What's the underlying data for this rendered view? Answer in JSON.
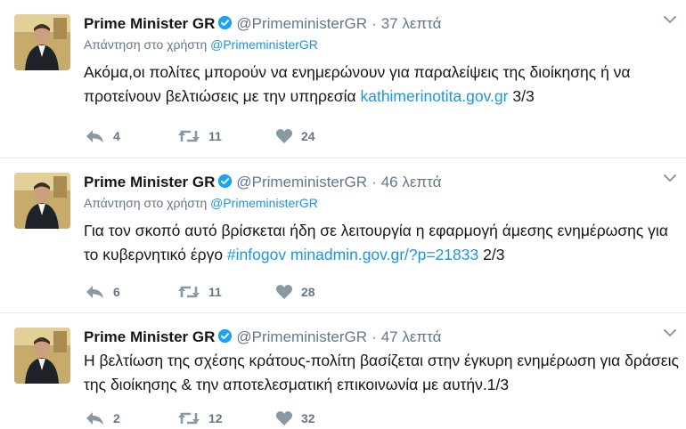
{
  "tweets": [
    {
      "name": "Prime Minister GR",
      "handle": "@PrimeministerGR",
      "sep": "·",
      "time": "37 λεπτά",
      "reply_prefix": "Απάντηση στο χρήστη",
      "reply_mention": "@PrimeministerGR",
      "text_before": "Ακόμα,οι πολίτες μπορούν να ενημερώνουν για παραλείψεις της διοίκησης ή να προτείνουν βελτιώσεις με την υπηρεσία ",
      "link1": "kathimerinotita.gov.gr",
      "between": "",
      "link2": "",
      "text_after": " 3/3",
      "reply_count": "4",
      "retweet_count": "11",
      "like_count": "24"
    },
    {
      "name": "Prime Minister GR",
      "handle": "@PrimeministerGR",
      "sep": "·",
      "time": "46 λεπτά",
      "reply_prefix": "Απάντηση στο χρήστη",
      "reply_mention": "@PrimeministerGR",
      "text_before": "Για τον σκοπό αυτό βρίσκεται ήδη σε λειτουργία η εφαρμογή άμεσης ενημέρωσης για το κυβερνητικό έργο ",
      "link1": "#infogov",
      "between": " ",
      "link2": "minadmin.gov.gr/?p=21833",
      "text_after": " 2/3",
      "reply_count": "6",
      "retweet_count": "11",
      "like_count": "28"
    },
    {
      "name": "Prime Minister GR",
      "handle": "@PrimeministerGR",
      "sep": "·",
      "time": "47 λεπτά",
      "reply_prefix": "",
      "reply_mention": "",
      "text_before": "Η βελτίωση της σχέσης κράτους-πολίτη βασίζεται στην έγκυρη ενημέρωση για δράσεις της διοίκησης & την αποτελεσματική επικοινωνία με αυτήν.1/3",
      "link1": "",
      "between": "",
      "link2": "",
      "text_after": "",
      "reply_count": "2",
      "retweet_count": "12",
      "like_count": "32"
    }
  ],
  "colors": {
    "link": "#1b95e0",
    "muted": "#657786",
    "verified": "#1da1f2",
    "border": "#e6ecf0"
  },
  "icons": [
    "reply-icon",
    "retweet-icon",
    "like-icon",
    "verified-icon",
    "caret-down-icon"
  ]
}
